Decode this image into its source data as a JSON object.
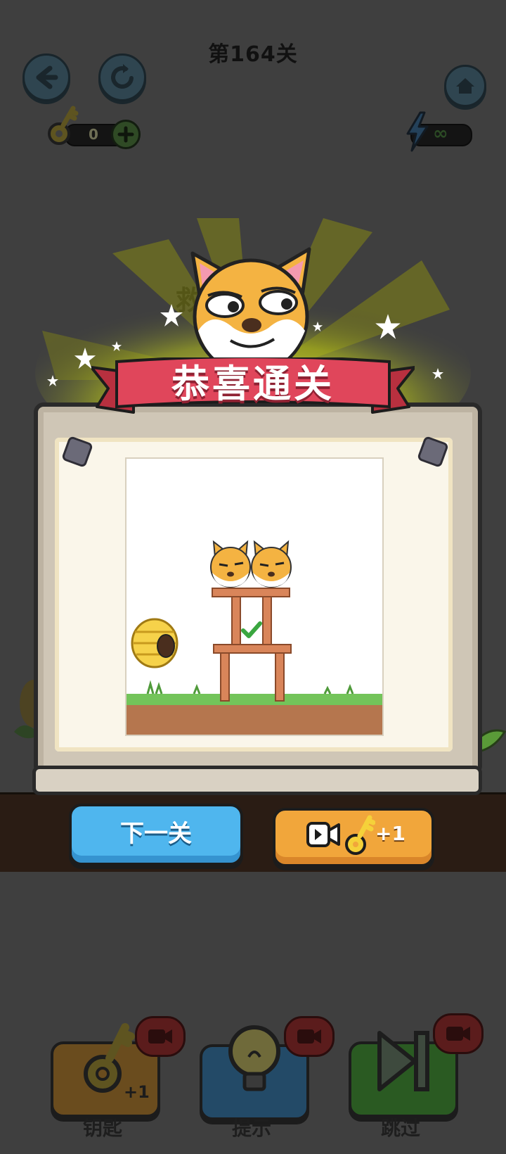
{
  "level": {
    "title": "第164关"
  },
  "resources": {
    "keys_count": "0",
    "energy_value": "∞"
  },
  "popup": {
    "title": "恭喜通关",
    "next_button_label": "下一关",
    "video_reward_label": "+1"
  },
  "background_hidden_text": "救",
  "tools": {
    "key_label": "钥匙",
    "key_badge": "+1",
    "hint_label": "提示",
    "skip_label": "跳过"
  },
  "colors": {
    "ribbon_red": "#e0465b",
    "next_button_blue": "#4fb6ee",
    "video_button_orange": "#f1a63b",
    "dog_orange": "#f4b342"
  }
}
